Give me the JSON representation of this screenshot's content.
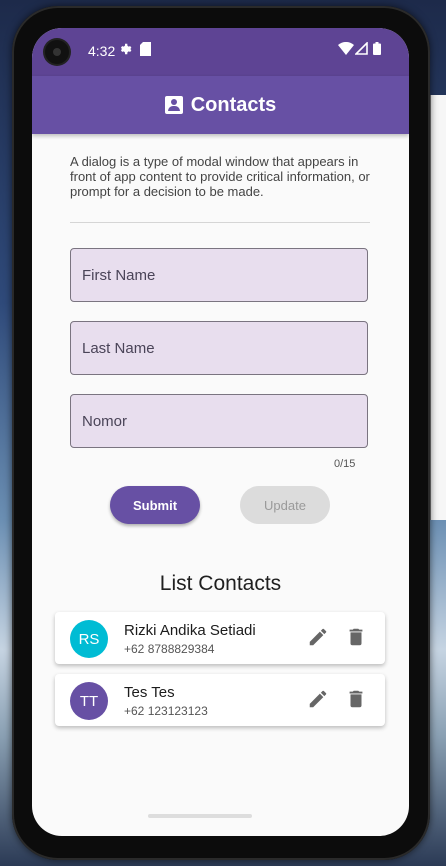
{
  "status_bar": {
    "time": "4:32",
    "icons": [
      "settings-icon",
      "sim-icon",
      "wifi-icon",
      "signal-icon",
      "battery-icon"
    ]
  },
  "app_bar": {
    "title": "Contacts",
    "icon": "contact-page-icon",
    "color": "#6750a4"
  },
  "description": "A dialog is a type of modal window that appears in front of app content to provide critical information, or prompt for a decision to be made.",
  "form": {
    "first_name_placeholder": "First Name",
    "last_name_placeholder": "Last Name",
    "nomor_placeholder": "Nomor",
    "nomor_counter": "0/15"
  },
  "buttons": {
    "submit": "Submit",
    "update": "Update"
  },
  "list": {
    "title": "List Contacts",
    "contacts": [
      {
        "initials": "RS",
        "name": "Rizki Andika Setiadi",
        "phone": "+62 8788829384",
        "avatar_color": "#00bcd4"
      },
      {
        "initials": "TT",
        "name": "Tes Tes",
        "phone": "+62 123123123",
        "avatar_color": "#6750a4"
      }
    ]
  }
}
